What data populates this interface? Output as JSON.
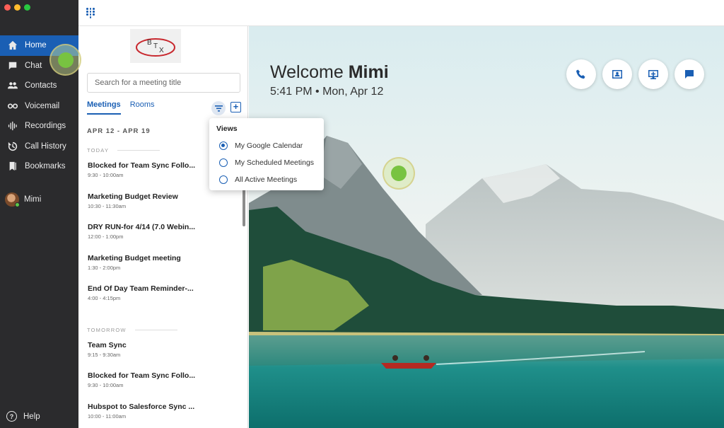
{
  "sidebar": {
    "traffic_colors": [
      "#fe5f57",
      "#febc2e",
      "#28c840"
    ],
    "items": [
      {
        "label": "Home",
        "icon": "home-icon",
        "active": true
      },
      {
        "label": "Chat",
        "icon": "chat-icon"
      },
      {
        "label": "Contacts",
        "icon": "contacts-icon"
      },
      {
        "label": "Voicemail",
        "icon": "voicemail-icon"
      },
      {
        "label": "Recordings",
        "icon": "recordings-icon"
      },
      {
        "label": "Call History",
        "icon": "call-history-icon"
      },
      {
        "label": "Bookmarks",
        "icon": "bookmarks-icon"
      }
    ],
    "user_name": "Mimi",
    "help_label": "Help"
  },
  "panel": {
    "logo_text": "BTX",
    "search_placeholder": "Search for a meeting title",
    "tabs": [
      "Meetings",
      "Rooms"
    ],
    "range": "APR 12 - APR 19",
    "today_label": "TODAY",
    "tomorrow_label": "TOMORROW",
    "today": [
      {
        "title": "Blocked for Team Sync Follo...",
        "time": "9:30 - 10:00am"
      },
      {
        "title": "Marketing Budget Review",
        "time": "10:30 - 11:30am"
      },
      {
        "title": "DRY RUN-for 4/14 (7.0 Webin...",
        "time": "12:00 - 1:00pm"
      },
      {
        "title": "Marketing Budget meeting",
        "time": "1:30 - 2:00pm"
      },
      {
        "title": "End Of Day Team Reminder-...",
        "time": "4:00 - 4:15pm"
      }
    ],
    "tomorrow": [
      {
        "title": "Team Sync",
        "time": "9:15 - 9:30am"
      },
      {
        "title": "Blocked for Team Sync Follo...",
        "time": "9:30 - 10:00am"
      },
      {
        "title": "Hubspot to Salesforce Sync ...",
        "time": "10:00 - 11:00am"
      }
    ]
  },
  "views_dropdown": {
    "header": "Views",
    "options": [
      "My Google Calendar",
      "My Scheduled Meetings",
      "All Active Meetings"
    ],
    "selected": "My Google Calendar"
  },
  "hero": {
    "welcome_prefix": "Welcome ",
    "user_name": "Mimi",
    "datetime": "5:41 PM • Mon, Apr 12",
    "actions": [
      "phone-icon",
      "contact-card-icon",
      "new-meeting-icon",
      "message-icon"
    ]
  },
  "colors": {
    "accent": "#1a5fb4",
    "sidebar_bg": "#2b2b2d",
    "click_indicator": "#78c341"
  }
}
